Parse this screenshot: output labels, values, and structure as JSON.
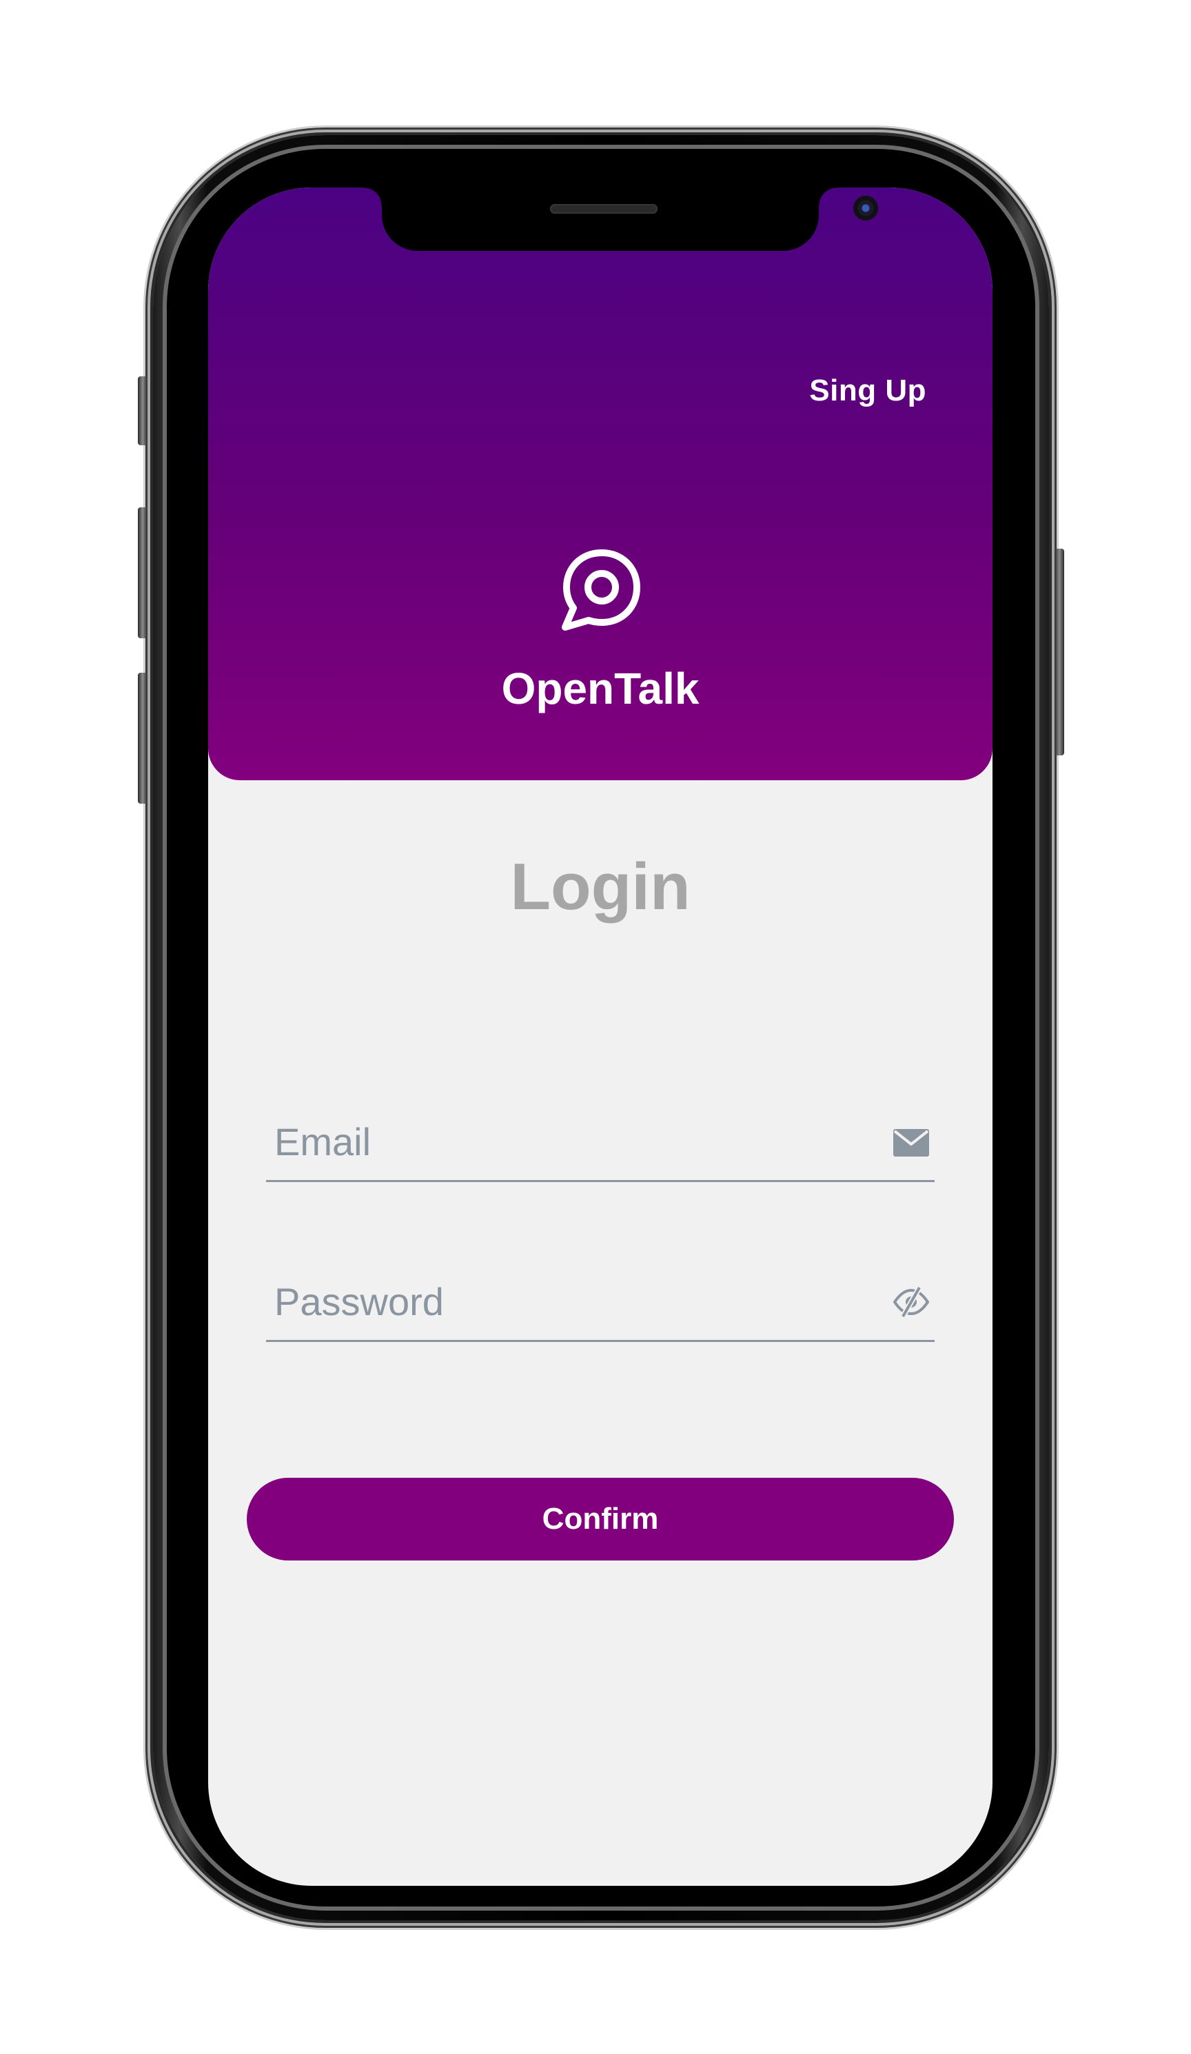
{
  "header": {
    "signup_label": "Sing Up",
    "app_name": "OpenTalk",
    "logo_icon": "chat-bubble-icon",
    "gradient": [
      "#4b0282",
      "#82007e"
    ]
  },
  "main": {
    "title": "Login",
    "email": {
      "placeholder": "Email",
      "value": "",
      "icon": "envelope-icon"
    },
    "password": {
      "placeholder": "Password",
      "value": "",
      "icon": "eye-slash-icon"
    },
    "confirm_label": "Confirm"
  },
  "colors": {
    "accent": "#82007e",
    "background": "#f1f1f2",
    "title_gray": "#a6a6a6",
    "field_line": "#8a95a0"
  }
}
